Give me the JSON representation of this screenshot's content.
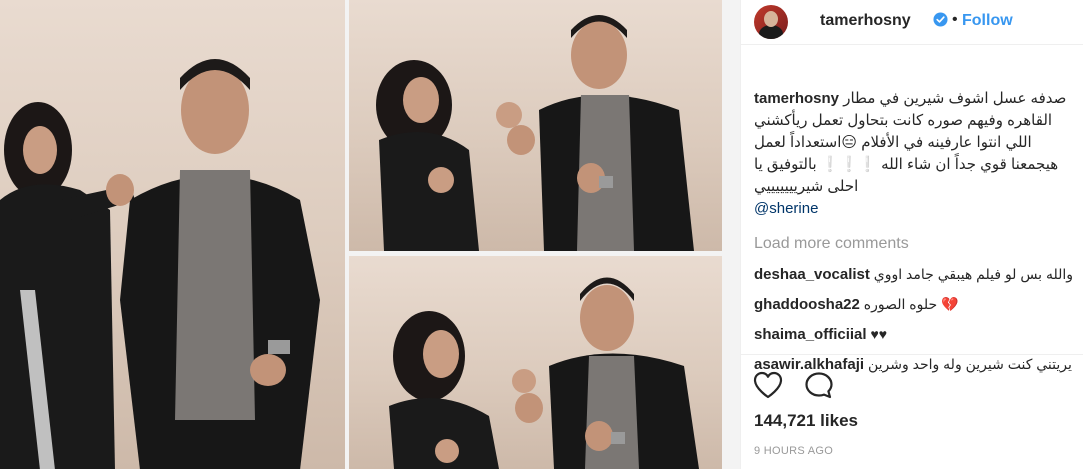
{
  "post": {
    "username": "tamerhosny",
    "follow_label": "Follow",
    "separator": "•",
    "caption_username": "tamerhosny",
    "caption_text": "صدفه عسل اشوف شيرين في مطار القاهره وفيهم صوره كانت بتحاول تعمل ريأكشني اللي انتوا عارفينه في الأفلام 😑استعداداً لعمل هيجمعنا قوي جداً ان شاء الله ❕❕❕ بالتوفيق يا احلى شيريييييييي",
    "mention": "@sherine",
    "load_more_label": "Load more comments",
    "comments": [
      {
        "username": "deshaa_vocalist",
        "text": "ه والله بس لو فيلم هيبقي جامد اووي"
      },
      {
        "username": "ghaddoosha22",
        "text": "حلوه الصوره 💔"
      },
      {
        "username": "shaima_officiial",
        "text": "♥♥"
      },
      {
        "username": "asawir.alkhafaji",
        "text": "يريتني كنت شيرين وله واحد وشرين"
      }
    ],
    "likes": "144,721 likes",
    "timestamp": "9 HOURS AGO"
  },
  "icons": {
    "verified": "verified-badge-icon",
    "like": "heart-icon",
    "comment": "comment-bubble-icon"
  },
  "colors": {
    "link_blue": "#3897f0",
    "mention_blue": "#003569",
    "muted_gray": "#999999",
    "text": "#262626"
  }
}
